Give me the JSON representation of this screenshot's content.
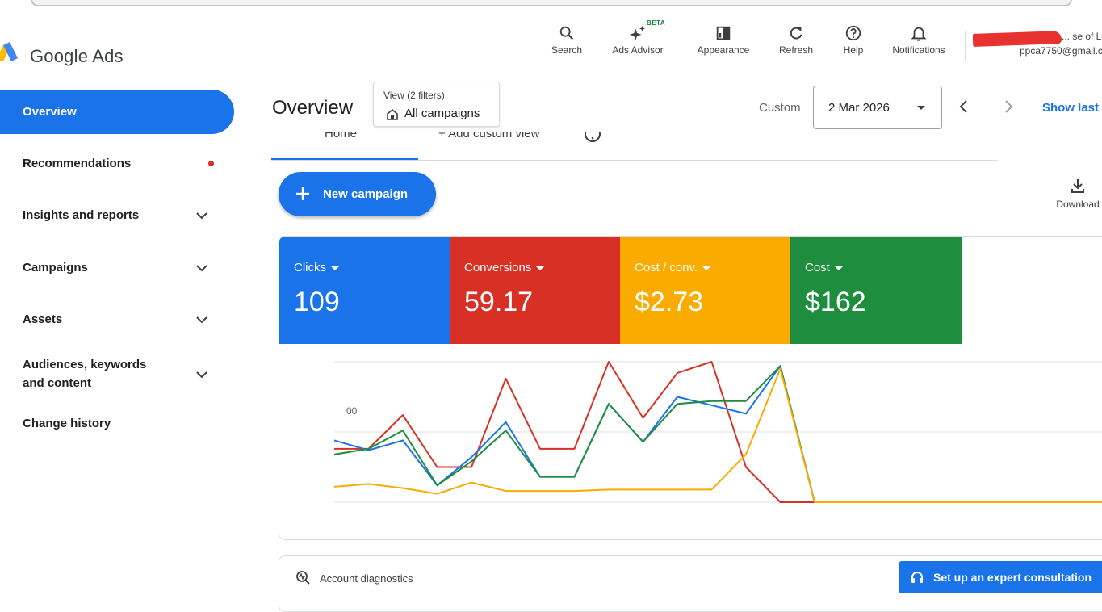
{
  "header": {
    "brand": "Google Ads",
    "tools": [
      {
        "label": "Search",
        "icon": "search-icon"
      },
      {
        "label": "Ads Advisor",
        "icon": "sparkle-icon",
        "badge": "BETA"
      },
      {
        "label": "Appearance",
        "icon": "appearance-icon"
      },
      {
        "label": "Refresh",
        "icon": "refresh-icon"
      },
      {
        "label": "Help",
        "icon": "help-icon"
      },
      {
        "label": "Notifications",
        "icon": "bell-icon"
      }
    ],
    "account": {
      "name": "... se of Lo",
      "email": "ppca7750@gmail.c"
    }
  },
  "sidebar": {
    "items": [
      {
        "label": "Overview",
        "active": true
      },
      {
        "label": "Recommendations",
        "dot": true
      },
      {
        "label": "Insights and reports",
        "chevron": true
      },
      {
        "label": "Campaigns",
        "chevron": true
      },
      {
        "label": "Assets",
        "chevron": true
      },
      {
        "label": "Audiences, keywords and content",
        "chevron": true
      },
      {
        "label": "Change history"
      }
    ]
  },
  "main": {
    "title": "Overview",
    "view_chip": {
      "line1": "View (2 filters)",
      "line2": "All campaigns"
    },
    "date_range": {
      "label": "Custom",
      "value": "2 Mar 2026"
    },
    "show_last": "Show last",
    "tabs": [
      {
        "label": "Home"
      },
      {
        "label": "+ Add custom view"
      }
    ],
    "new_campaign": "New campaign",
    "download": "Download",
    "diagnostics_label": "Account diagnostics",
    "expert_button": "Set up an expert consultation"
  },
  "metrics": [
    {
      "name": "Clicks",
      "value": "109",
      "color": "#1a73e8"
    },
    {
      "name": "Conversions",
      "value": "59.17",
      "color": "#d93025"
    },
    {
      "name": "Cost / conv.",
      "value": "$2.73",
      "color": "#f9ab00"
    },
    {
      "name": "Cost",
      "value": "$162",
      "color": "#1e8e3e"
    }
  ],
  "chart_data": {
    "type": "line",
    "x_tick_labels": [
      "00"
    ],
    "ylim": [
      0,
      100
    ],
    "grid": true,
    "series": [
      {
        "color": "#d93025",
        "values": [
          38,
          38,
          62,
          25,
          25,
          88,
          38,
          38,
          100,
          60,
          92,
          100,
          25,
          0,
          0,
          0,
          0,
          0,
          0,
          0,
          0,
          0,
          0,
          0,
          0
        ]
      },
      {
        "color": "#1a73e8",
        "values": [
          44,
          37,
          44,
          12,
          32,
          57,
          18,
          18,
          70,
          43,
          75,
          69,
          63,
          97,
          0,
          0,
          0,
          0,
          0,
          0,
          0,
          0,
          0,
          0,
          0
        ]
      },
      {
        "color": "#1e8e3e",
        "values": [
          34,
          38,
          51,
          12,
          29,
          51,
          18,
          18,
          70,
          43,
          70,
          72,
          72,
          97,
          0,
          0,
          0,
          0,
          0,
          0,
          0,
          0,
          0,
          0,
          0
        ]
      },
      {
        "color": "#f9ab00",
        "values": [
          11,
          13,
          10,
          6,
          14,
          8,
          8,
          8,
          9,
          9,
          9,
          9,
          34,
          95,
          0,
          0,
          0,
          0,
          0,
          0,
          0,
          0,
          0,
          0,
          0
        ]
      }
    ]
  }
}
